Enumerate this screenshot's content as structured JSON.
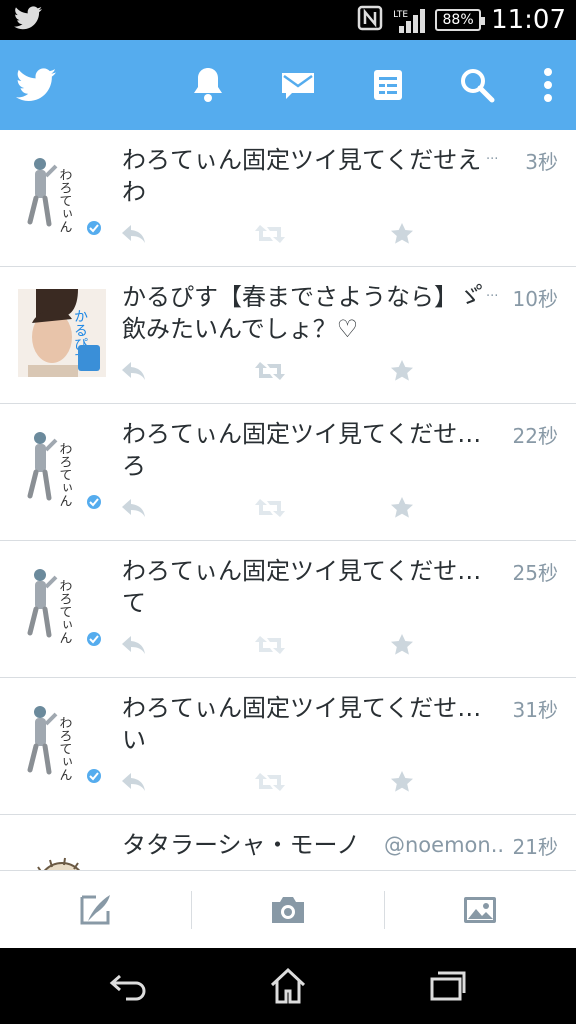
{
  "status_bar": {
    "time": "11:07",
    "battery": "88%",
    "network": "LTE",
    "icons": [
      "twitter-notification-icon",
      "nfc-icon",
      "signal-icon",
      "battery-icon"
    ]
  },
  "app_bar": {
    "icons": [
      "twitter-logo-icon",
      "notifications-icon",
      "messages-icon",
      "lists-icon",
      "search-icon",
      "overflow-menu-icon"
    ],
    "color": "#55acee"
  },
  "tweets": [
    {
      "text": "わろてぃん固定ツイ見てくだせえわ",
      "handle": "",
      "time": "3秒",
      "avatar": "わろてぃん"
    },
    {
      "text": "かるぴす【春までさようなら】ゞ゚ 飲みたいんでしょ？♡",
      "handle": "",
      "time": "10秒",
      "avatar": "かるぴす"
    },
    {
      "text": "わろてぃん固定ツイ見てくだせ… ろ",
      "handle": "",
      "time": "22秒",
      "avatar": "わろてぃん"
    },
    {
      "text": "わろてぃん固定ツイ見てくだせ… て",
      "handle": "",
      "time": "25秒",
      "avatar": "わろてぃん"
    },
    {
      "text": "わろてぃん固定ツイ見てくだせ… い",
      "handle": "",
      "time": "31秒",
      "avatar": "わろてぃん"
    },
    {
      "text": "タタラーシャ・モーノ",
      "handle": "@noemon...",
      "time": "21秒",
      "avatar": ""
    }
  ],
  "tweet_actions": [
    "reply-icon",
    "retweet-icon",
    "favorite-icon"
  ],
  "compose_bar": {
    "icons": [
      "compose-tweet-icon",
      "camera-icon",
      "gallery-icon"
    ]
  },
  "nav_bar": {
    "icons": [
      "back-icon",
      "home-icon",
      "recent-apps-icon"
    ]
  },
  "ellipsis": "..."
}
